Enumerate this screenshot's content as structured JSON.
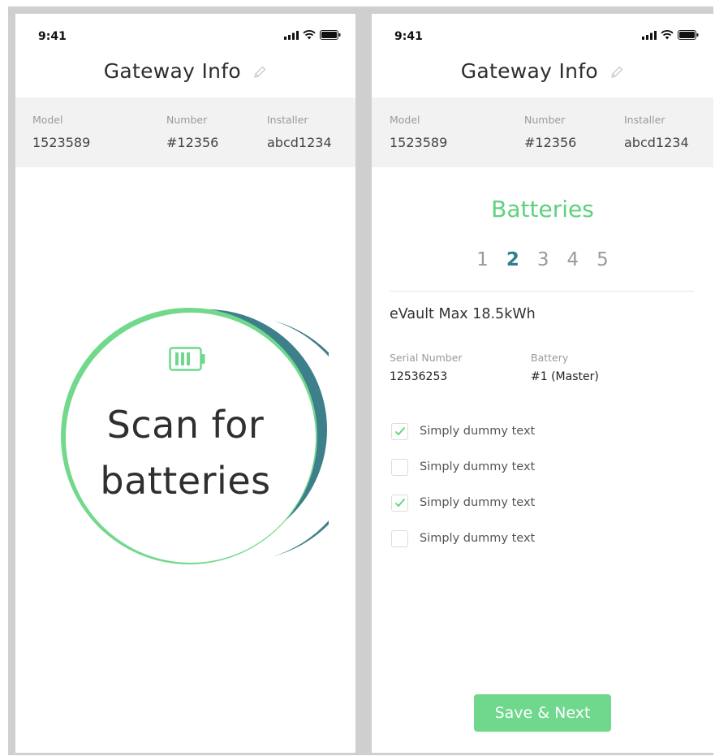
{
  "status": {
    "time": "9:41"
  },
  "header": {
    "title": "Gateway Info"
  },
  "info": {
    "model_label": "Model",
    "model_value": "1523589",
    "number_label": "Number",
    "number_value": "#12356",
    "installer_label": "Installer",
    "installer_value": "abcd1234"
  },
  "scan": {
    "line1": "Scan for",
    "line2": "batteries"
  },
  "batteries": {
    "title": "Batteries",
    "pages": [
      "1",
      "2",
      "3",
      "4",
      "5"
    ],
    "active_page": "2",
    "product_name": "eVault Max 18.5kWh",
    "serial_label": "Serial Number",
    "serial_value": "12536253",
    "battery_label": "Battery",
    "battery_value": "#1 (Master)",
    "checklist": [
      {
        "label": "Simply dummy text",
        "checked": true
      },
      {
        "label": "Simply dummy text",
        "checked": false
      },
      {
        "label": "Simply dummy text",
        "checked": true
      },
      {
        "label": "Simply dummy text",
        "checked": false
      }
    ],
    "save_label": "Save & Next"
  },
  "colors": {
    "accent_green": "#5fd17d",
    "accent_teal": "#2e7f8f",
    "button_green": "#6fd88d"
  },
  "icons": [
    "signal-icon",
    "wifi-icon",
    "battery-status-icon",
    "pencil-icon",
    "battery-icon",
    "checkmark-icon"
  ]
}
